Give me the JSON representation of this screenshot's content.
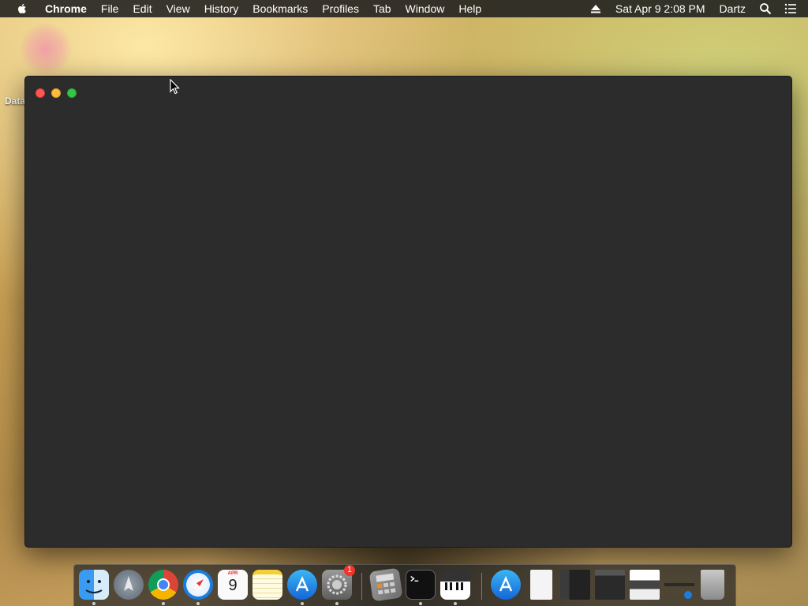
{
  "menubar": {
    "app_name": "Chrome",
    "items": [
      "File",
      "Edit",
      "View",
      "History",
      "Bookmarks",
      "Profiles",
      "Tab",
      "Window",
      "Help"
    ],
    "datetime": "Sat Apr 9  2:08 PM",
    "user": "Dartz"
  },
  "desktop": {
    "label": "Data"
  },
  "dock": {
    "calendar": {
      "month": "APR",
      "day": "9"
    },
    "settings_badge": "1",
    "apps": [
      {
        "name": "finder-icon",
        "running": true
      },
      {
        "name": "launchpad-icon",
        "running": false
      },
      {
        "name": "chrome-icon",
        "running": true
      },
      {
        "name": "safari-icon",
        "running": true
      },
      {
        "name": "calendar-icon",
        "running": false
      },
      {
        "name": "notes-icon",
        "running": false
      },
      {
        "name": "app-store-icon",
        "running": true
      },
      {
        "name": "system-preferences-icon",
        "running": true
      },
      {
        "name": "calculator-icon",
        "running": false
      },
      {
        "name": "terminal-icon",
        "running": true
      },
      {
        "name": "piano-icon",
        "running": true
      },
      {
        "name": "downloads-folder-icon",
        "running": false
      },
      {
        "name": "document-icon",
        "running": false
      },
      {
        "name": "window-thumbnail-icon",
        "running": false
      },
      {
        "name": "window-thumbnail-icon",
        "running": false
      },
      {
        "name": "window-thumbnail-icon",
        "running": false
      },
      {
        "name": "window-thumbnail-icon",
        "running": false
      },
      {
        "name": "trash-icon",
        "running": false
      }
    ]
  }
}
